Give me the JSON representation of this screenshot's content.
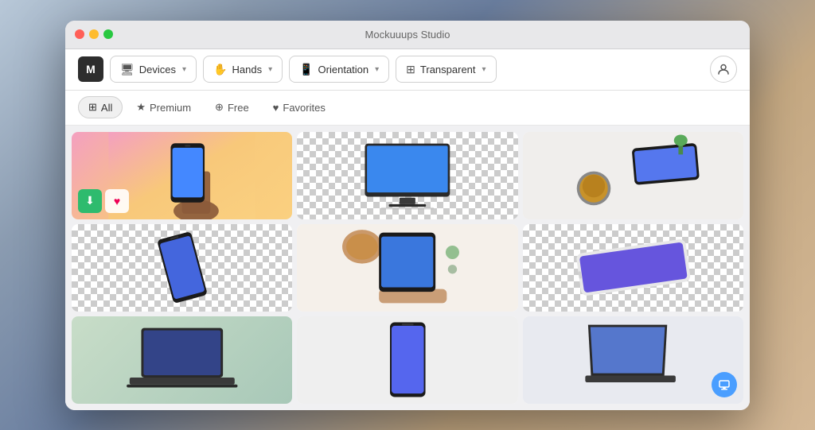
{
  "window": {
    "title": "Mockuuups Studio"
  },
  "toolbar": {
    "logo_label": "M",
    "dropdowns": [
      {
        "id": "devices",
        "icon": "🖥",
        "label": "Devices"
      },
      {
        "id": "hands",
        "icon": "🖐",
        "label": "Hands"
      },
      {
        "id": "orientation",
        "icon": "📱",
        "label": "Orientation"
      },
      {
        "id": "transparent",
        "icon": "⊞",
        "label": "Transparent"
      }
    ],
    "user_icon": "👤"
  },
  "filters": [
    {
      "id": "all",
      "icon": "⊞",
      "label": "All",
      "active": true
    },
    {
      "id": "premium",
      "icon": "★",
      "label": "Premium",
      "active": false
    },
    {
      "id": "free",
      "icon": "⊕",
      "label": "Free",
      "active": false
    },
    {
      "id": "favorites",
      "icon": "♥",
      "label": "Favorites",
      "active": false
    }
  ],
  "grid_items": [
    {
      "id": 1,
      "type": "phone-hand-gradient",
      "show_actions": true
    },
    {
      "id": 2,
      "type": "monitor-transparent",
      "show_actions": false
    },
    {
      "id": 3,
      "type": "phone-coffee",
      "show_actions": false
    },
    {
      "id": 4,
      "type": "phone-tilted-transparent",
      "show_actions": false
    },
    {
      "id": 5,
      "type": "tablet-hand",
      "show_actions": false
    },
    {
      "id": 6,
      "type": "phone-landscape-transparent",
      "show_actions": false
    },
    {
      "id": 7,
      "type": "laptop-green",
      "show_actions": false
    },
    {
      "id": 8,
      "type": "phone-upright",
      "show_actions": false
    },
    {
      "id": 9,
      "type": "laptop-desk",
      "show_actions": false
    }
  ],
  "actions": {
    "download_label": "⬇",
    "favorite_label": "♥"
  },
  "colors": {
    "accent_green": "#2ebb6e",
    "accent_blue": "#4a9eff",
    "active_filter_bg": "#f0f0f0"
  }
}
